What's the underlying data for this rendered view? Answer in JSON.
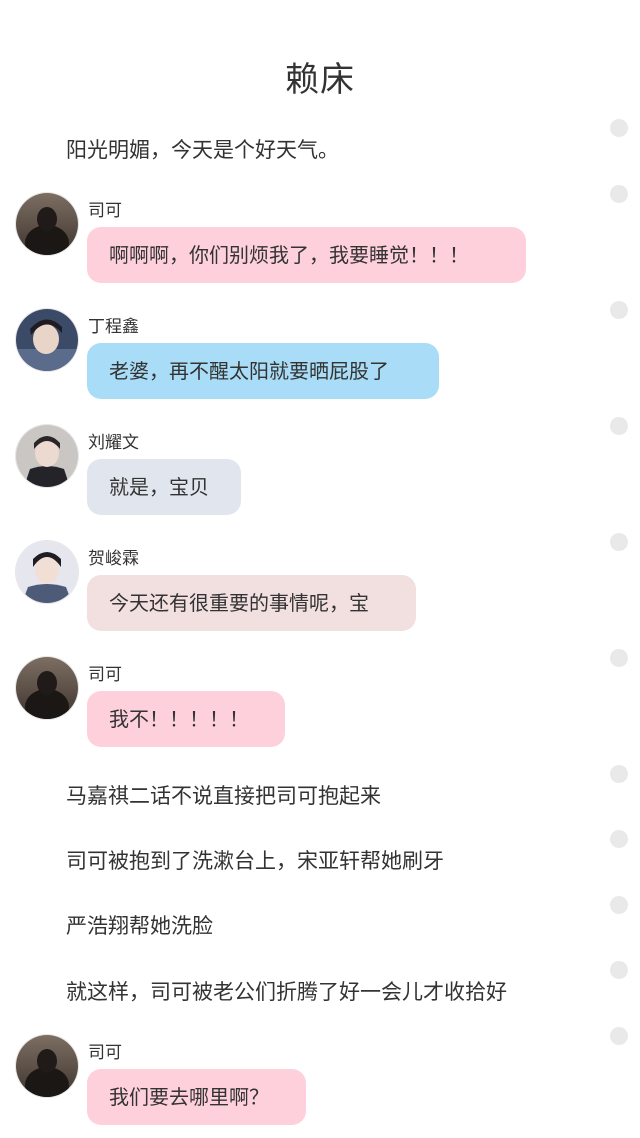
{
  "title": "赖床",
  "narration": [
    "阳光明媚，今天是个好天气。",
    "马嘉祺二话不说直接把司可抱起来",
    "司可被抱到了洗漱台上，宋亚轩帮她刷牙",
    "严浩翔帮她洗脸",
    "就这样，司可被老公们折腾了好一会儿才收拾好"
  ],
  "messages": [
    {
      "name": "司可",
      "text": "啊啊啊，你们别烦我了，我要睡觉！！！",
      "bubble_color": "#fdd0dc"
    },
    {
      "name": "丁程鑫",
      "text": "老婆，再不醒太阳就要晒屁股了",
      "bubble_color": "#a9dcf6"
    },
    {
      "name": "刘耀文",
      "text": "就是，宝贝",
      "bubble_color": "#e1e6ee"
    },
    {
      "name": "贺峻霖",
      "text": "今天还有很重要的事情呢，宝",
      "bubble_color": "#f2dfe0"
    },
    {
      "name": "司可",
      "text": "我不！！！！！",
      "bubble_color": "#fdd0dc"
    },
    {
      "name": "司可",
      "text": "我们要去哪里啊？",
      "bubble_color": "#fdd0dc"
    }
  ],
  "avatars": {
    "sike": "avatar-sike",
    "ding": "avatar-dingchengxin",
    "liu": "avatar-liuyaowen",
    "he": "avatar-hejunlin"
  }
}
